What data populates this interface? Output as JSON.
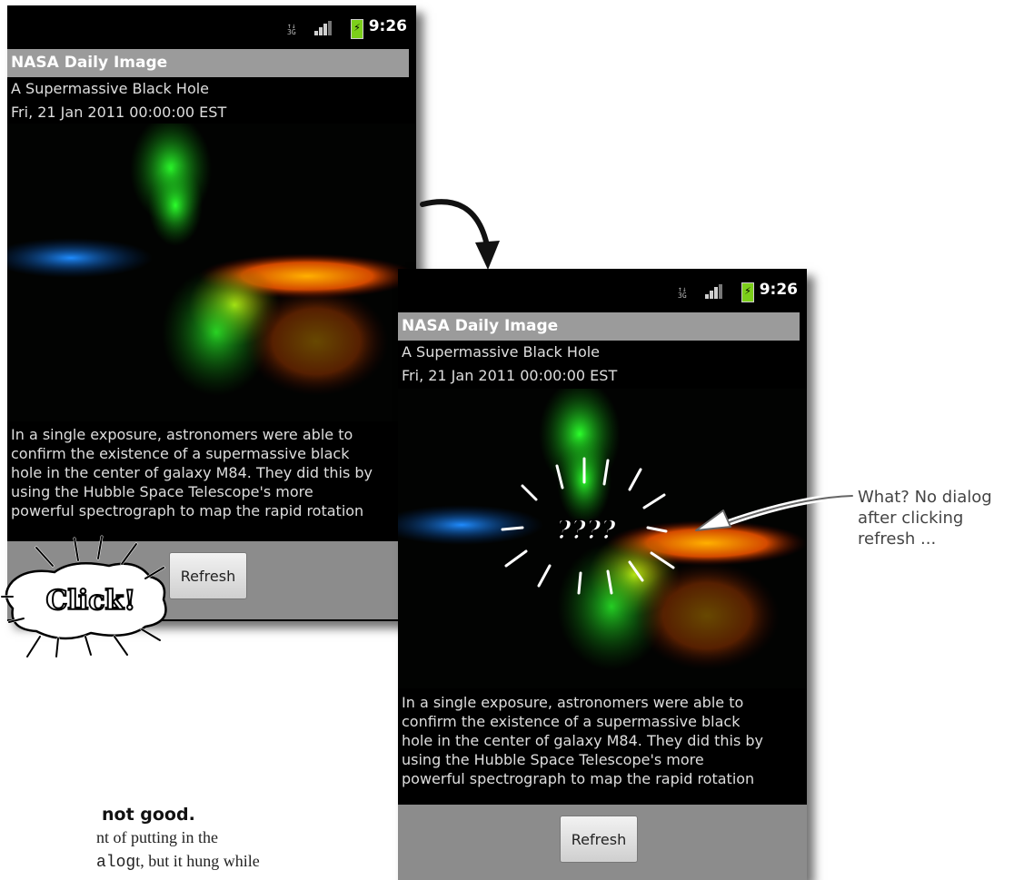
{
  "status_bar": {
    "time": "9:26",
    "network_icon": "data-network-icon",
    "signal_icon": "signal-bars-icon",
    "battery_icon": "battery-charging-icon"
  },
  "app": {
    "title": "NASA Daily Image",
    "image_title": "A Supermassive Black Hole",
    "date": "Fri, 21 Jan 2011 00:00:00 EST",
    "description_lines": [
      "In a single exposure, astronomers were able to",
      "confirm the existence of a supermassive black",
      "hole in the center of galaxy M84. They did this by",
      "using the Hubble Space Telescope's more",
      "powerful spectrograph to map the rapid rotation"
    ],
    "refresh_label": "Refresh"
  },
  "annotations": {
    "click_burst": "Click!",
    "question_burst": "????",
    "note_lines": [
      "What? No dialog",
      "after clicking",
      "refresh ..."
    ]
  },
  "page_text": {
    "heading": "not good.",
    "line1": "nt of putting in the",
    "line2_code": "alog",
    "line2_rest": "t, but it hung while"
  }
}
